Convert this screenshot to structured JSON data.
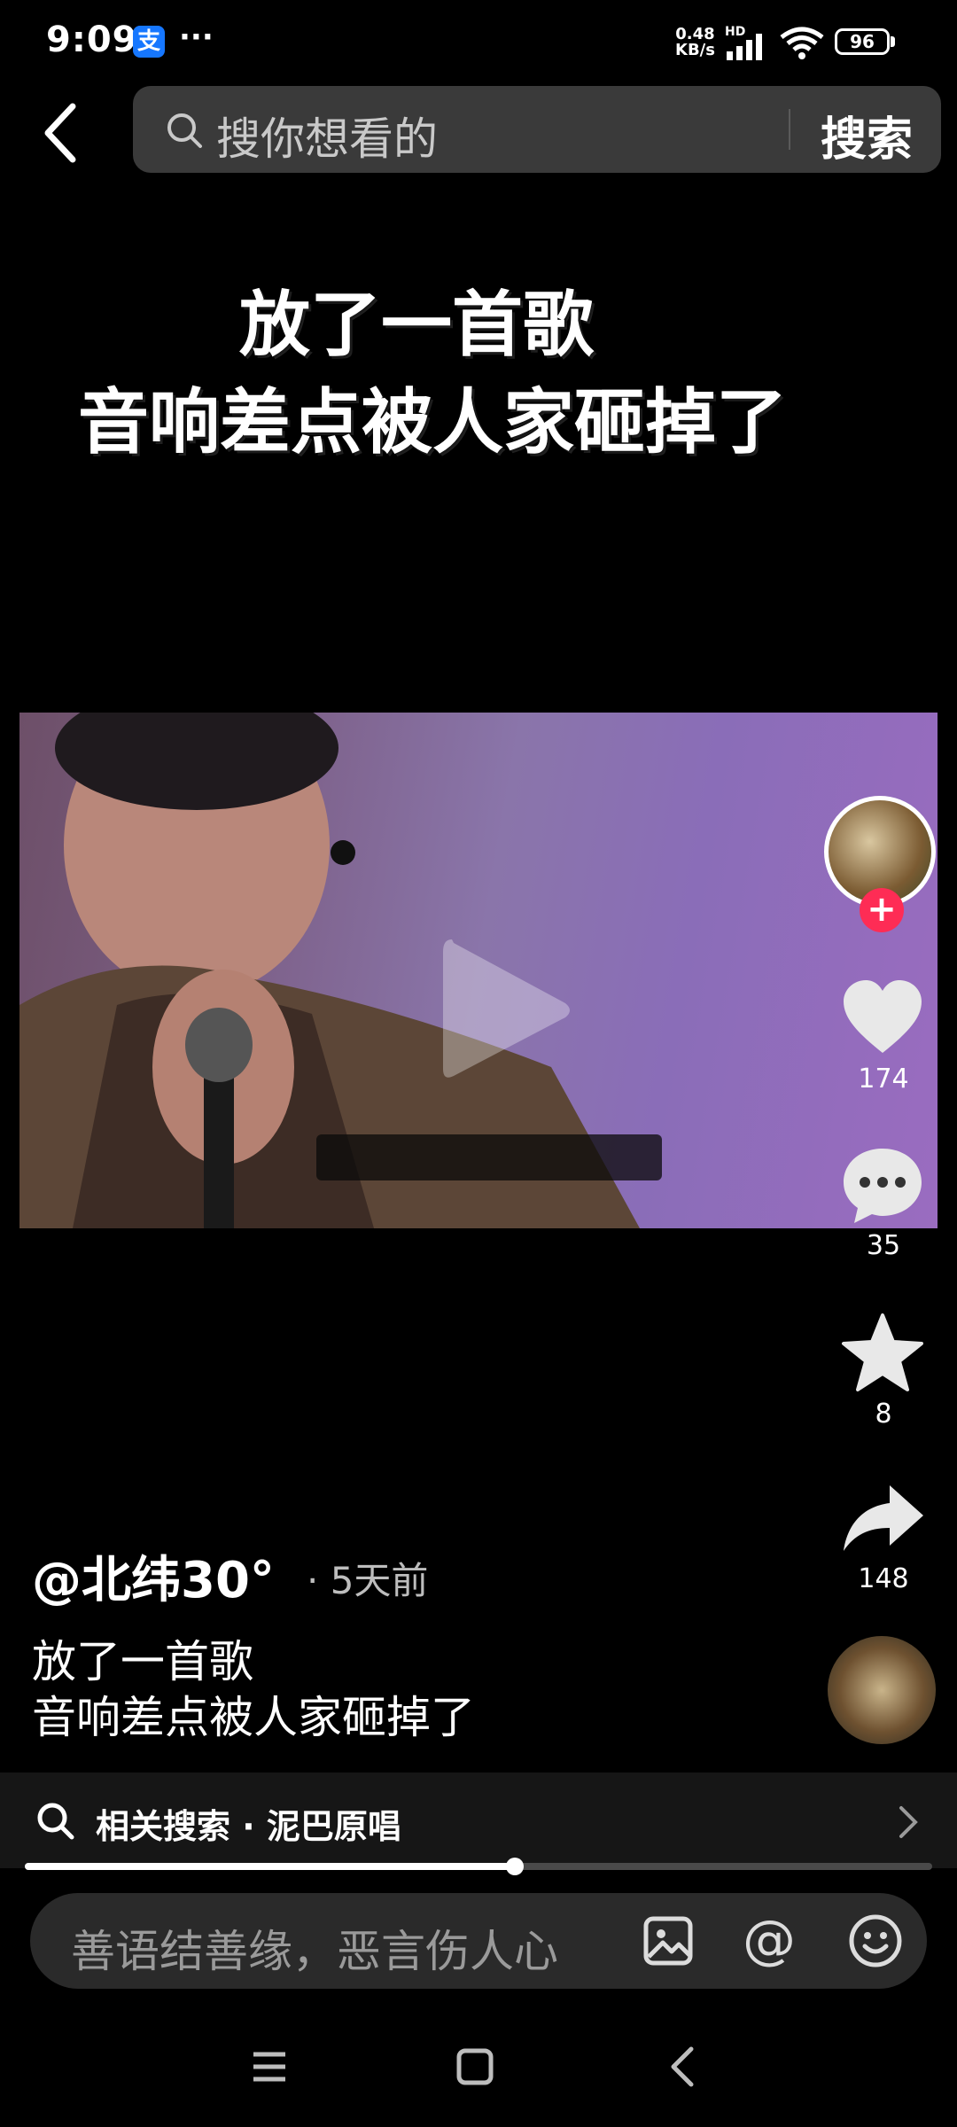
{
  "status_bar": {
    "time": "9:09",
    "app_badge": "支",
    "more": "···",
    "net_speed_value": "0.48",
    "net_speed_unit": "KB/s",
    "network_label": "HD",
    "battery": "96"
  },
  "header": {
    "search_placeholder": "搜你想看的",
    "search_button": "搜索"
  },
  "overlay_caption": {
    "line1": "放了一首歌",
    "line2": "音响差点被人家砸掉了"
  },
  "actions": {
    "likes": "174",
    "comments": "35",
    "favorites": "8",
    "shares": "148",
    "follow_symbol": "+"
  },
  "post": {
    "author": "@北纬30°",
    "time": "· 5天前",
    "desc_line1": "放了一首歌",
    "desc_line2": "音响差点被人家砸掉了"
  },
  "related_search": {
    "text": "相关搜索 · 泥巴原唱"
  },
  "playback": {
    "progress": 0.54
  },
  "comment_input": {
    "placeholder": "善语结善缘，恶言伤人心",
    "mention_symbol": "@"
  },
  "colors": {
    "accent": "#fe2c55",
    "background": "#000000"
  }
}
